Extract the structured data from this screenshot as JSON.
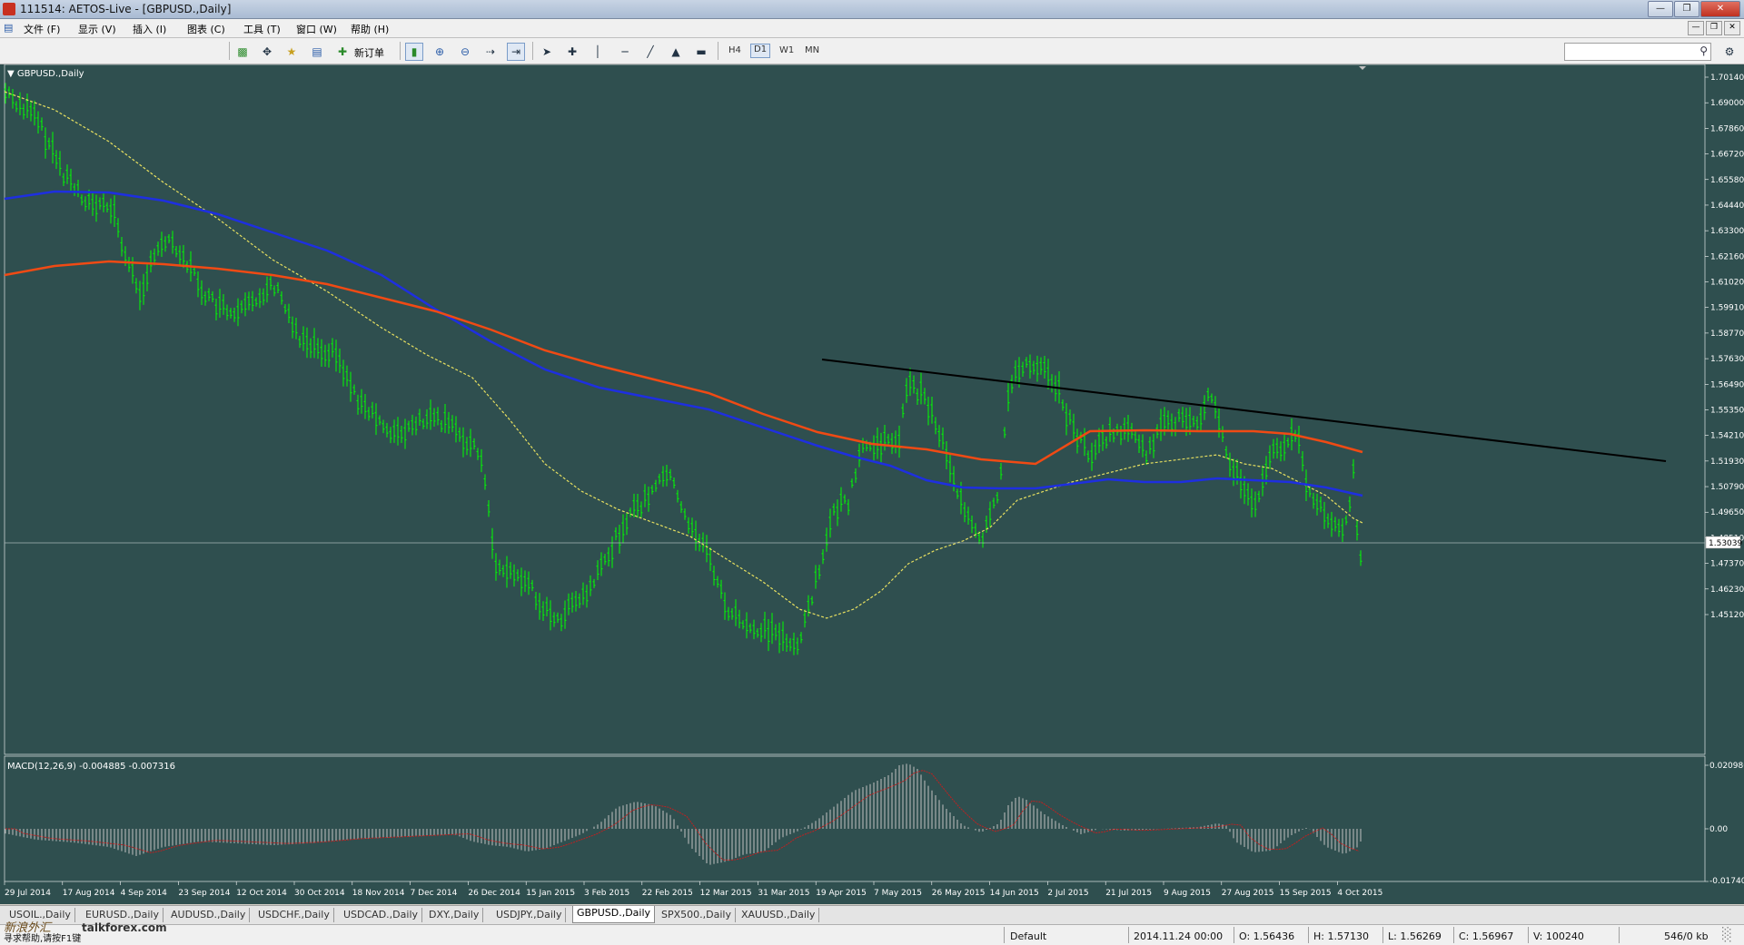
{
  "window": {
    "title": "111514: AETOS-Live - [GBPUSD.,Daily]"
  },
  "menu": [
    "文件 (F)",
    "显示 (V)",
    "插入 (I)",
    "图表 (C)",
    "工具 (T)",
    "窗口 (W)",
    "帮助 (H)"
  ],
  "toolbar": {
    "new_order": "新订单",
    "timeframes": [
      "H4",
      "D1",
      "W1",
      "MN"
    ],
    "active_timeframe": "D1"
  },
  "chart": {
    "symbol_label": "GBPUSD.,Daily",
    "current_price": "1.53039",
    "price_ticks": [
      "1.70140",
      "1.69000",
      "1.67860",
      "1.66720",
      "1.65580",
      "1.64440",
      "1.63300",
      "1.62160",
      "1.61020",
      "1.59910",
      "1.58770",
      "1.57630",
      "1.56490",
      "1.55350",
      "1.54210",
      "1.53039",
      "1.51930",
      "1.50790",
      "1.49650",
      "1.48510",
      "1.47370",
      "1.46230",
      "1.45120"
    ],
    "date_ticks": [
      "29 Jul 2014",
      "17 Aug 2014",
      "4 Sep 2014",
      "23 Sep 2014",
      "12 Oct 2014",
      "30 Oct 2014",
      "18 Nov 2014",
      "7 Dec 2014",
      "26 Dec 2014",
      "15 Jan 2015",
      "3 Feb 2015",
      "22 Feb 2015",
      "12 Mar 2015",
      "31 Mar 2015",
      "19 Apr 2015",
      "7 May 2015",
      "26 May 2015",
      "14 Jun 2015",
      "2 Jul 2015",
      "21 Jul 2015",
      "9 Aug 2015",
      "27 Aug 2015",
      "15 Sep 2015",
      "4 Oct 2015"
    ],
    "colors": {
      "background": "#2f4f4f",
      "candles": "#00ff00",
      "ma_blue": "#1e2fe0",
      "ma_orange": "#f04a14",
      "ma_yellow": "#e8e060",
      "trendline": "#000000",
      "macd_hist": "#c0c0c0",
      "macd_signal": "#c02020"
    }
  },
  "macd": {
    "label": "MACD(12,26,9) -0.004885 -0.007316",
    "ticks": [
      "0.020986",
      "0.00",
      "-0.017403"
    ]
  },
  "tabs": [
    "USOIL.,Daily",
    "EURUSD.,Daily",
    "AUDUSD.,Daily",
    "USDCHF.,Daily",
    "USDCAD.,Daily",
    "DXY.,Daily",
    "USDJPY.,Daily",
    "GBPUSD.,Daily",
    "SPX500.,Daily",
    "XAUUSD.,Daily"
  ],
  "active_tab": "GBPUSD.,Daily",
  "status": {
    "help": "寻求帮助,请按F1键",
    "profile": "Default",
    "datetime": "2014.11.24 00:00",
    "open": "O: 1.56436",
    "high": "H: 1.57130",
    "low": "L: 1.56269",
    "close": "C: 1.56967",
    "volume": "V: 100240",
    "traffic": "546/0 kb"
  },
  "watermark": {
    "cn": "新浪外汇",
    "site": "talkforex.com"
  }
}
